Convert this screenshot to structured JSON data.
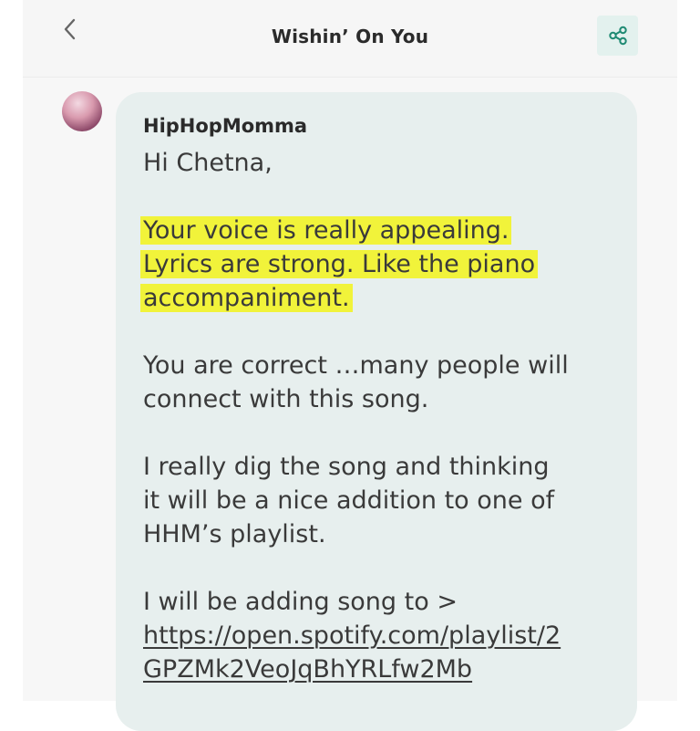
{
  "header": {
    "title": "Wishin’ On You",
    "back_icon": "chevron-left-icon",
    "share_icon": "share-icon"
  },
  "colors": {
    "accent": "#1f8a73",
    "share_bg": "#e3f1ee",
    "bubble_bg": "#e7efee",
    "highlight": "#f1f33a"
  },
  "comment": {
    "username": "HipHopMomma",
    "lines": {
      "greeting": "Hi Chetna,",
      "hl1": "Your voice is really appealing.",
      "hl2": "Lyrics are strong. Like the piano",
      "hl3": "accompaniment.",
      "p2a": "You are correct …many people will",
      "p2b": "connect with this song.",
      "p3a": "I really dig the song and thinking",
      "p3b": "it will be a nice addition to one of",
      "p3c": "HHM’s playlist.",
      "p4a": "I will be adding song to >",
      "link1": "https://open.spotify.com/playlist/2",
      "link2": "GPZMk2VeoJqBhYRLfw2Mb"
    }
  }
}
